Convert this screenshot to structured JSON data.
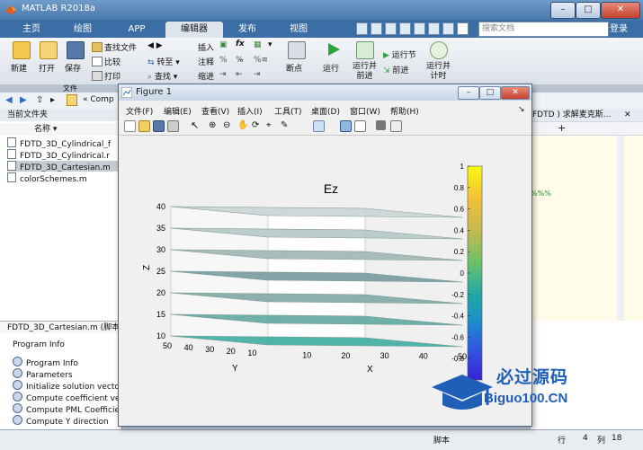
{
  "window": {
    "title": "MATLAB R2018a"
  },
  "tabs": [
    {
      "label": "主页"
    },
    {
      "label": "绘图"
    },
    {
      "label": "APP"
    },
    {
      "label": "编辑器"
    },
    {
      "label": "发布"
    },
    {
      "label": "视图"
    }
  ],
  "search": {
    "placeholder": "搜索文档"
  },
  "login": "登录",
  "ribbon": {
    "new": "新建",
    "open": "打开",
    "save": "保存",
    "find_files": "查找文件",
    "compare": "比较",
    "print": "打印",
    "goto": "转至",
    "find": "查找",
    "insert": "插入",
    "comment": "注释",
    "indent": "缩进",
    "breakpoint": "断点",
    "run": "运行",
    "run_advance": "运行并\n前进",
    "run_section": "运行节",
    "advance": "前进",
    "run_time": "运行并\n计时",
    "group_file": "文件"
  },
  "path": {
    "text": "« Comp"
  },
  "left": {
    "current_folder": "当前文件夹",
    "name_col": "名称 ▾",
    "files": [
      {
        "name": "FDTD_3D_Cylindrical_f"
      },
      {
        "name": "FDTD_3D_Cylindrical.r"
      },
      {
        "name": "FDTD_3D_Cartesian.m"
      },
      {
        "name": "colorSchemes.m"
      }
    ],
    "details_title": "FDTD_3D_Cartesian.m (脚本",
    "program_info": "Program Info",
    "sections": [
      {
        "label": "Program Info"
      },
      {
        "label": "Parameters"
      },
      {
        "label": "Initialize solution vector"
      },
      {
        "label": "Compute coefficient ve"
      },
      {
        "label": "Compute PML Coefficie"
      },
      {
        "label": "Compute Y direction"
      }
    ]
  },
  "editor_right": {
    "tab_text": "FDTD ) 求解麦克斯..."
  },
  "status": {
    "script": "脚本",
    "row_label": "行",
    "row": "4",
    "col_label": "列",
    "col": "18"
  },
  "figure": {
    "title": "Figure 1",
    "menu": [
      "文件(F)",
      "编辑(E)",
      "查看(V)",
      "插入(I)",
      "工具(T)",
      "桌面(D)",
      "窗口(W)",
      "帮助(H)"
    ]
  },
  "chart_data": {
    "type": "surface",
    "title": "Ez",
    "xlabel": "X",
    "ylabel": "Y",
    "zlabel": "Z",
    "z_ticks": [
      10,
      15,
      20,
      25,
      30,
      35,
      40
    ],
    "x_ticks": [
      10,
      20,
      30,
      40,
      50
    ],
    "y_ticks": [
      10,
      20,
      30,
      40,
      50
    ],
    "slices_z": [
      10,
      15,
      20,
      25,
      30,
      35,
      40
    ],
    "slice_colors": [
      "#3eaea0",
      "#5fa79e",
      "#80a7a4",
      "#789a9e",
      "#9fb6b4",
      "#b6c6c6",
      "#c8d4d4"
    ],
    "colorbar": {
      "min": -1,
      "max": 1,
      "ticks": [
        1,
        0.8,
        0.6,
        0.4,
        0.2,
        0,
        -0.2,
        -0.4,
        -0.6,
        -0.8
      ],
      "tick_labels": [
        "1",
        "0.8",
        "0.6",
        "0.4",
        "0.2",
        "0",
        "-0.2",
        "-0.4",
        "-0.6",
        "-0.8"
      ]
    }
  },
  "watermark": {
    "cn": "必过源码",
    "en": "Biguo100.CN"
  }
}
